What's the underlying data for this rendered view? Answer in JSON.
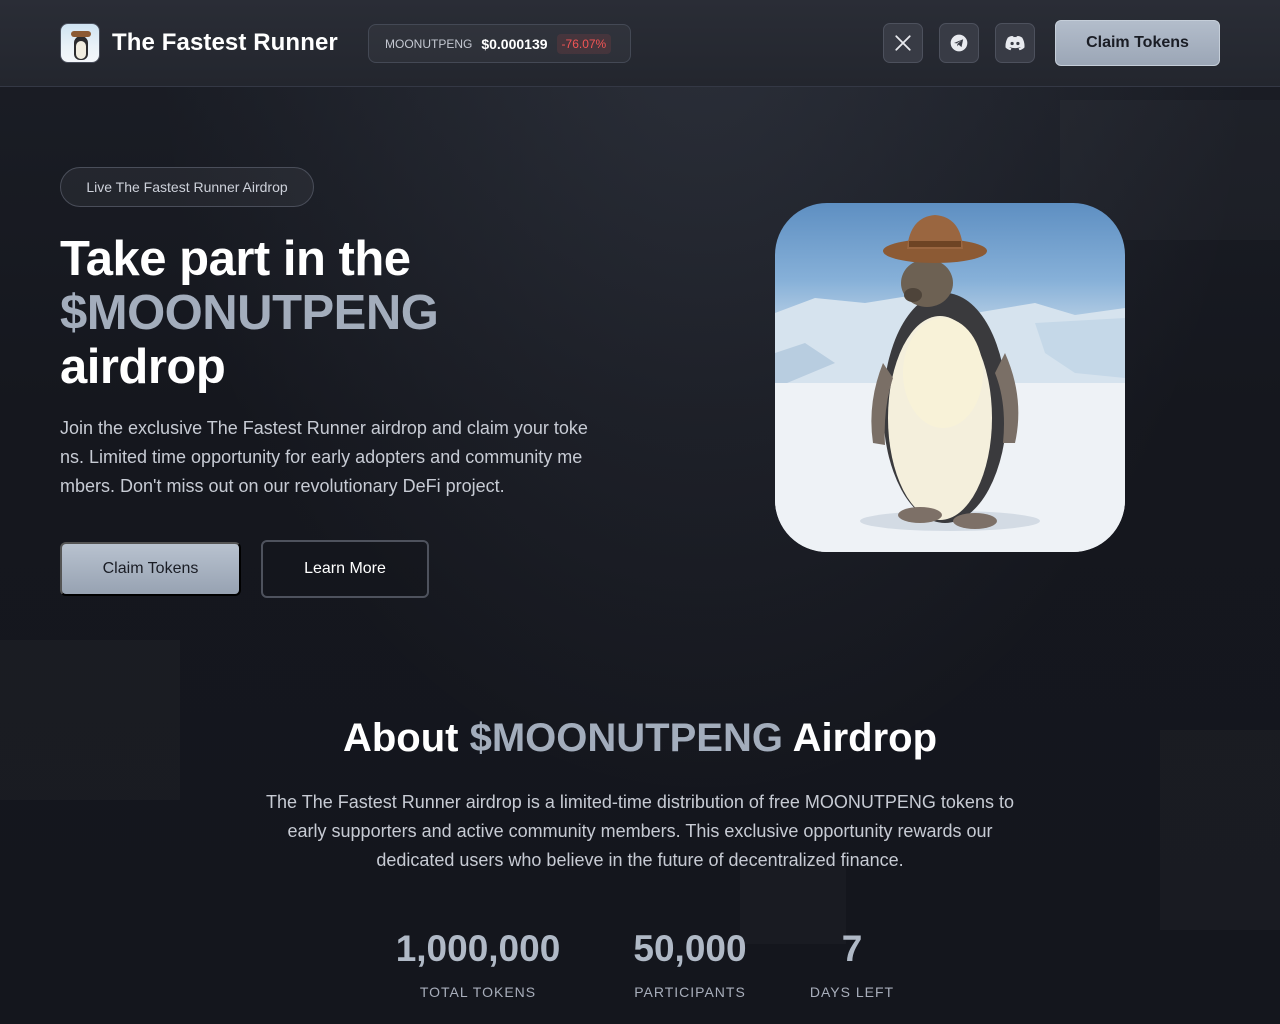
{
  "header": {
    "brand_name": "The Fastest Runner",
    "ticker": {
      "symbol": "MOONUTPENG",
      "price": "$0.000139",
      "change": "-76.07%"
    },
    "social": [
      "x-icon",
      "telegram-icon",
      "discord-icon"
    ],
    "cta_label": "Claim Tokens"
  },
  "hero": {
    "badge": "Live The Fastest Runner Airdrop",
    "title_line1": "Take part in the",
    "title_accent": "$MOONUTPENG",
    "title_line3": "airdrop",
    "description": "Join the exclusive The Fastest Runner airdrop and claim your tokens. Limited time opportunity for early adopters and community members. Don't miss out on our revolutionary DeFi project.",
    "primary_button": "Claim Tokens",
    "secondary_button": "Learn More"
  },
  "about": {
    "title_prefix": "About",
    "title_accent": "$MOONUTPENG",
    "title_suffix": "Airdrop",
    "description": "The The Fastest Runner airdrop is a limited-time distribution of free MOONUTPENG tokens to early supporters and active community members. This exclusive opportunity rewards our dedicated users who believe in the future of decentralized finance.",
    "stats": [
      {
        "value": "1,000,000",
        "label": "TOTAL TOKENS"
      },
      {
        "value": "50,000",
        "label": "PARTICIPANTS"
      },
      {
        "value": "7",
        "label": "DAYS LEFT"
      }
    ]
  },
  "colors": {
    "background": "#14161d",
    "accent": "#a3adbc",
    "negative": "#f25555"
  }
}
